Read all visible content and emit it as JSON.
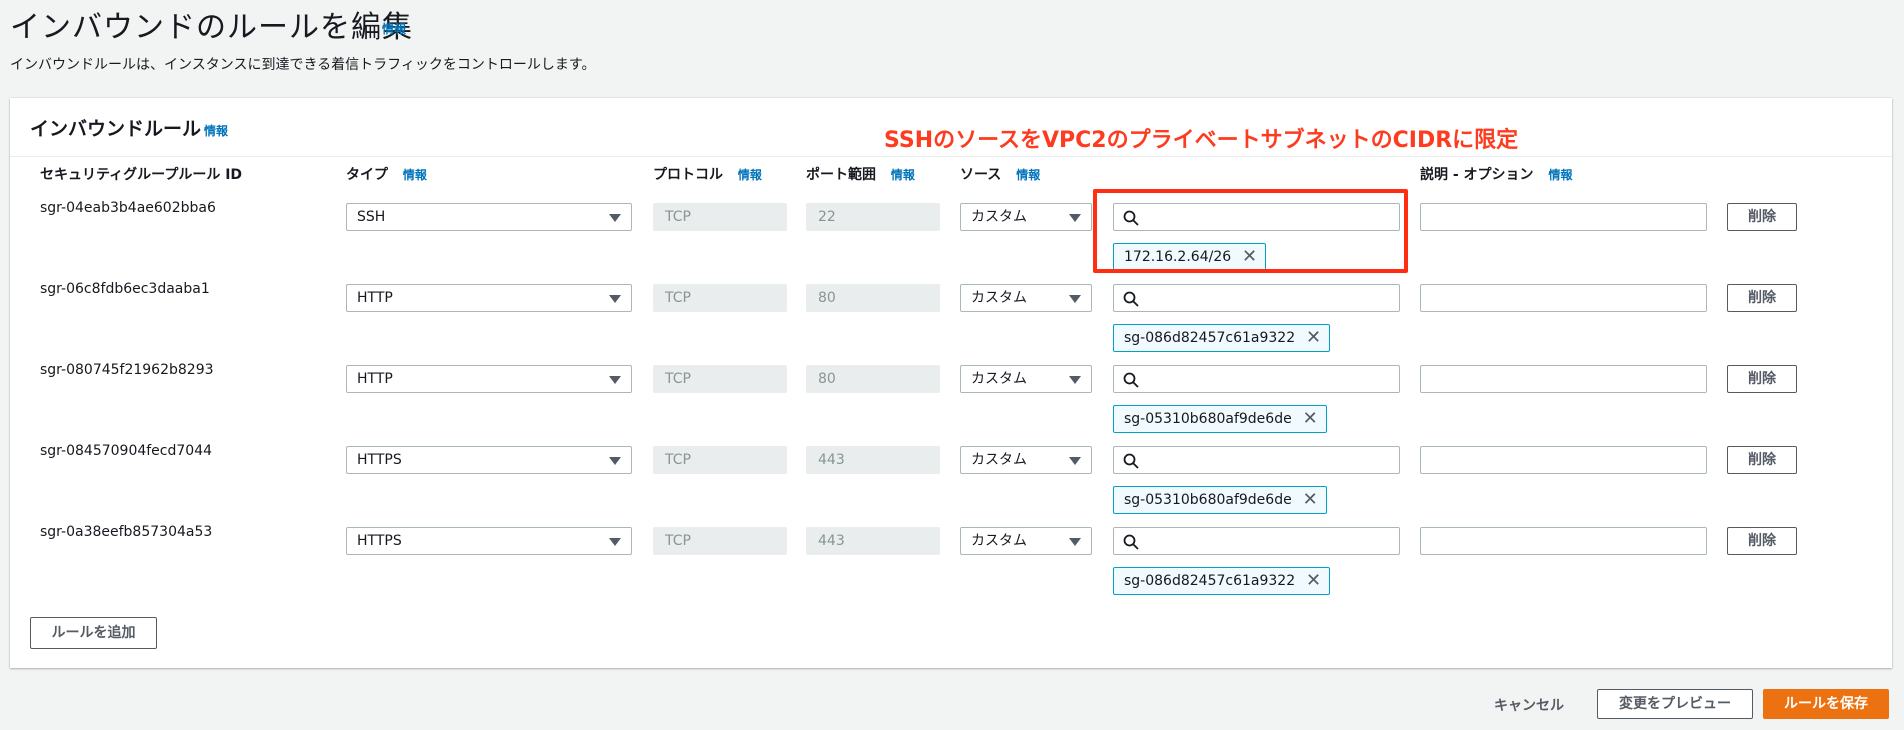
{
  "page": {
    "title": "インバウンドのルールを編集",
    "info": "情報",
    "description": "インバウンドルールは、インスタンスに到達できる着信トラフィックをコントロールします。"
  },
  "panel": {
    "title": "インバウンドルール",
    "info": "情報",
    "annotation": "SSHのソースをVPC2のプライベートサブネットのCIDRに限定",
    "columns": {
      "rule_id": "セキュリティグループルール ID",
      "type": "タイプ",
      "protocol": "プロトコル",
      "port": "ポート範囲",
      "source": "ソース",
      "description": "説明 - オプション",
      "info": "情報"
    },
    "rules": [
      {
        "id": "sgr-04eab3b4ae602bba6",
        "type": "SSH",
        "protocol": "TCP",
        "port": "22",
        "source_mode": "カスタム",
        "source_token": "172.16.2.64/26",
        "delete": "削除"
      },
      {
        "id": "sgr-06c8fdb6ec3daaba1",
        "type": "HTTP",
        "protocol": "TCP",
        "port": "80",
        "source_mode": "カスタム",
        "source_token": "sg-086d82457c61a9322",
        "delete": "削除"
      },
      {
        "id": "sgr-080745f21962b8293",
        "type": "HTTP",
        "protocol": "TCP",
        "port": "80",
        "source_mode": "カスタム",
        "source_token": "sg-05310b680af9de6de",
        "delete": "削除"
      },
      {
        "id": "sgr-084570904fecd7044",
        "type": "HTTPS",
        "protocol": "TCP",
        "port": "443",
        "source_mode": "カスタム",
        "source_token": "sg-05310b680af9de6de",
        "delete": "削除"
      },
      {
        "id": "sgr-0a38eefb857304a53",
        "type": "HTTPS",
        "protocol": "TCP",
        "port": "443",
        "source_mode": "カスタム",
        "source_token": "sg-086d82457c61a9322",
        "delete": "削除"
      }
    ],
    "add_rule": "ルールを追加"
  },
  "footer": {
    "cancel": "キャンセル",
    "preview": "変更をプレビュー",
    "save": "ルールを保存"
  },
  "colors": {
    "accent": "#ec7211",
    "link": "#0073bb",
    "annotation": "#ff3b1f",
    "token_border": "#00a1c9"
  }
}
